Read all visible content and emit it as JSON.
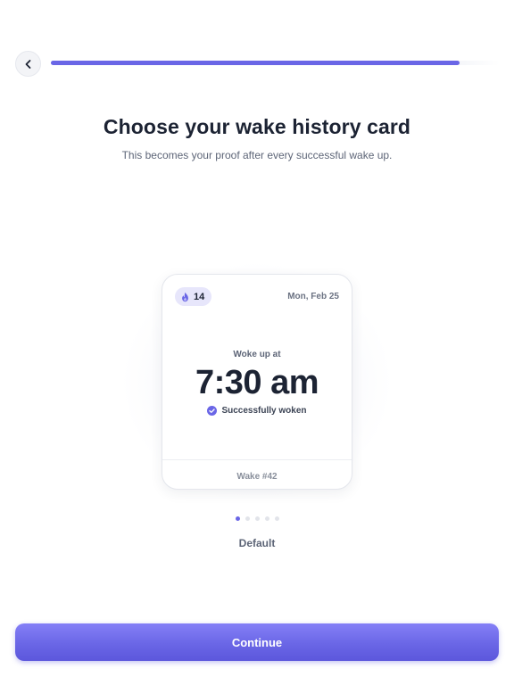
{
  "header": {
    "back_icon": "chevron-left-icon",
    "progress_percent": 91
  },
  "title": "Choose your wake history card",
  "subtitle": "This becomes your proof after every successful wake up.",
  "card": {
    "streak_icon": "flame-icon",
    "streak_count": "14",
    "date": "Mon, Feb 25",
    "woke_label": "Woke up at",
    "time": "7:30 am",
    "success_icon": "check-circle-icon",
    "success_label": "Successfully woken",
    "wake_number": "Wake #42"
  },
  "pager": {
    "total": 5,
    "active_index": 0
  },
  "style_name": "Default",
  "continue_label": "Continue",
  "colors": {
    "accent": "#6a66e6",
    "text_primary": "#1c2333",
    "text_secondary": "#5d6577",
    "badge_bg": "#e7e6fb"
  }
}
